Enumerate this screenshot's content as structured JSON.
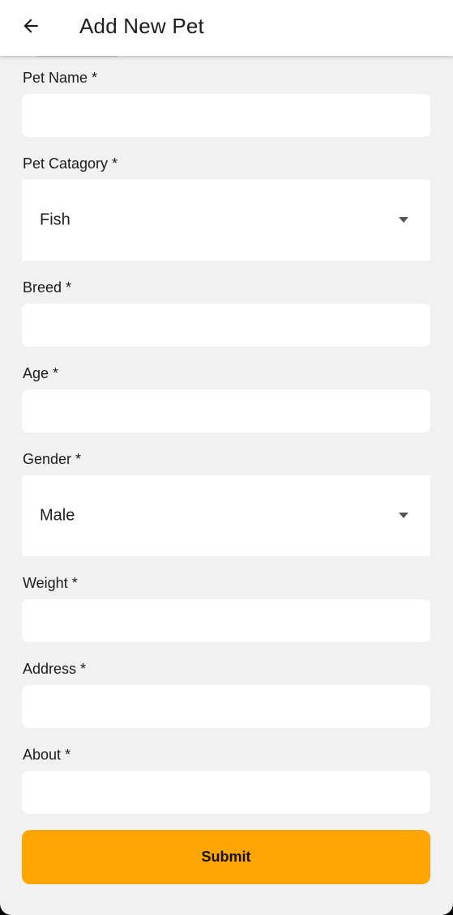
{
  "appbar": {
    "title": "Add New Pet",
    "back_icon": "arrow-left-icon"
  },
  "form": {
    "pet_name": {
      "label": "Pet Name *",
      "value": ""
    },
    "pet_category": {
      "label": "Pet Catagory *",
      "value": "Fish"
    },
    "breed": {
      "label": "Breed *",
      "value": ""
    },
    "age": {
      "label": "Age *",
      "value": ""
    },
    "gender": {
      "label": "Gender *",
      "value": "Male"
    },
    "weight": {
      "label": "Weight *",
      "value": ""
    },
    "address": {
      "label": "Address *",
      "value": ""
    },
    "about": {
      "label": "About *",
      "value": ""
    },
    "submit_label": "Submit"
  },
  "colors": {
    "accent": "#fca503",
    "background": "#f1f1f1",
    "field": "#ffffff"
  }
}
